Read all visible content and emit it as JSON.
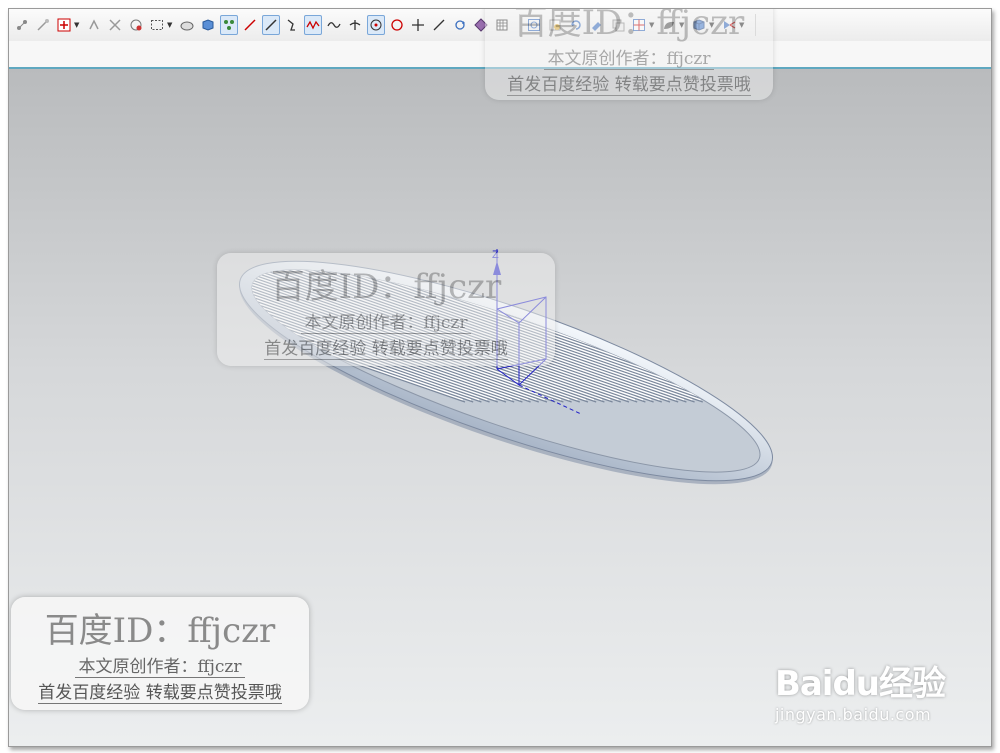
{
  "toolbar": {
    "icons": [
      "snap-point-icon",
      "end-point-icon",
      "mid-point-icon",
      "control-point-icon",
      "intersection-point-icon",
      "arc-center-icon",
      "select-box-icon",
      "solid-view-icon",
      "shaded-box-icon",
      "feature-point-icon",
      "line-icon",
      "line-2-icon",
      "curve-icon",
      "spline-icon",
      "wave-icon",
      "perpendicular-icon",
      "circle-center-icon",
      "circle-icon",
      "plus-icon",
      "tangent-icon",
      "rotate-icon",
      "hatch-icon",
      "grid-icon",
      "fit-view-icon",
      "zoom-icon",
      "orbit-icon",
      "pan-icon",
      "layer-icon",
      "render-style-icon",
      "material-icon",
      "view-cube-icon",
      "view-triad-icon"
    ]
  },
  "model": {
    "axis_label": "Z"
  },
  "watermark_top": {
    "line1_prefix": "百度ID：",
    "line1_name": "ffjczr",
    "line2": "本文原创作者：ffjczr",
    "line3": "首发百度经验 转载要点赞投票哦"
  },
  "watermark_center": {
    "line1_prefix": "百度ID：",
    "line1_name": "ffjczr",
    "line2": "本文原创作者：ffjczr",
    "line3": "首发百度经验 转载要点赞投票哦"
  },
  "watermark_bottom": {
    "line1_prefix": "百度ID：",
    "line1_name": "ffjczr",
    "line2": "本文原创作者：ffjczr",
    "line3": "首发百度经验 转载要点赞投票哦"
  },
  "brand": {
    "logo": "Baidu经验",
    "url": "jingyan.baidu.com"
  }
}
